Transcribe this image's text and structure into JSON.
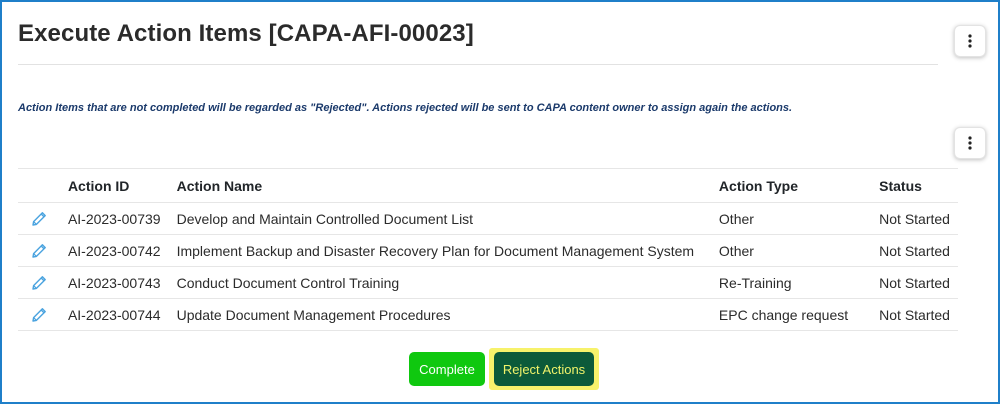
{
  "header": {
    "title": "Execute Action Items [CAPA-AFI-00023]",
    "menu_icon": "kebab-vertical-icon"
  },
  "notice": "Action Items that are not completed will be regarded as \"Rejected\". Actions rejected will be sent to CAPA content owner to assign again the actions.",
  "grid": {
    "menu_icon": "kebab-vertical-icon",
    "columns": {
      "edit": "",
      "action_id": "Action ID",
      "action_name": "Action Name",
      "action_type": "Action Type",
      "status": "Status"
    },
    "rows": [
      {
        "action_id": "AI-2023-00739",
        "action_name": "Develop and Maintain Controlled Document List",
        "action_type": "Other",
        "status": "Not Started"
      },
      {
        "action_id": "AI-2023-00742",
        "action_name": "Implement Backup and Disaster Recovery Plan for Document Management System",
        "action_type": "Other",
        "status": "Not Started"
      },
      {
        "action_id": "AI-2023-00743",
        "action_name": "Conduct Document Control Training",
        "action_type": "Re-Training",
        "status": "Not Started"
      },
      {
        "action_id": "AI-2023-00744",
        "action_name": "Update Document Management Procedures",
        "action_type": "EPC change request",
        "status": "Not Started"
      }
    ],
    "row_icon": "pencil-edit-icon"
  },
  "actions": {
    "complete_label": "Complete",
    "reject_label": "Reject Actions"
  },
  "colors": {
    "frame_border": "#1f7fc9",
    "notice_text": "#1b3a6b",
    "status_text": "#7b1fa2",
    "complete_bg": "#0fc80f",
    "reject_bg": "#0c5a3a",
    "reject_text": "#f1f36a",
    "highlight": "#f7f26b",
    "pencil_icon": "#4aa3df"
  }
}
